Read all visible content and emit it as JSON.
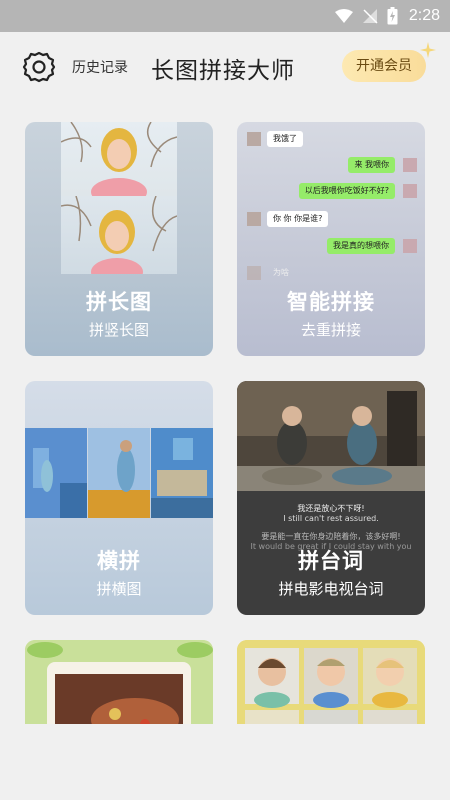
{
  "status_bar": {
    "time": "2:28"
  },
  "header": {
    "history_label": "历史记录",
    "title": "长图拼接大师",
    "vip_label": "开通会员"
  },
  "cards": [
    {
      "title": "拼长图",
      "subtitle": "拼竖长图"
    },
    {
      "title": "智能拼接",
      "subtitle": "去重拼接"
    },
    {
      "title": "横拼",
      "subtitle": "拼横图"
    },
    {
      "title": "拼台词",
      "subtitle": "拼电影电视台词"
    }
  ],
  "chat_sample": {
    "m1": "我饿了",
    "m2": "来 我喂你",
    "m3": "以后我喂你吃饭好不好?",
    "m4": "你 你 你是谁?",
    "m5": "我是真的想喂你",
    "m6": "为啥"
  },
  "subtitle_sample": {
    "zh1": "我还是放心不下呀!",
    "en1": "I still can't rest assured.",
    "zh2": "要是能一直在你身边陪着你，该多好啊!",
    "en2": "It would be great if I could stay with you"
  },
  "colors": {
    "vip_gradient_start": "#fde9b2",
    "vip_gradient_end": "#f9dc9a",
    "chat_green": "#95ec69"
  },
  "icons": [
    "wifi-icon",
    "signal-icon",
    "battery-icon",
    "gear-icon",
    "sparkle-icon"
  ]
}
